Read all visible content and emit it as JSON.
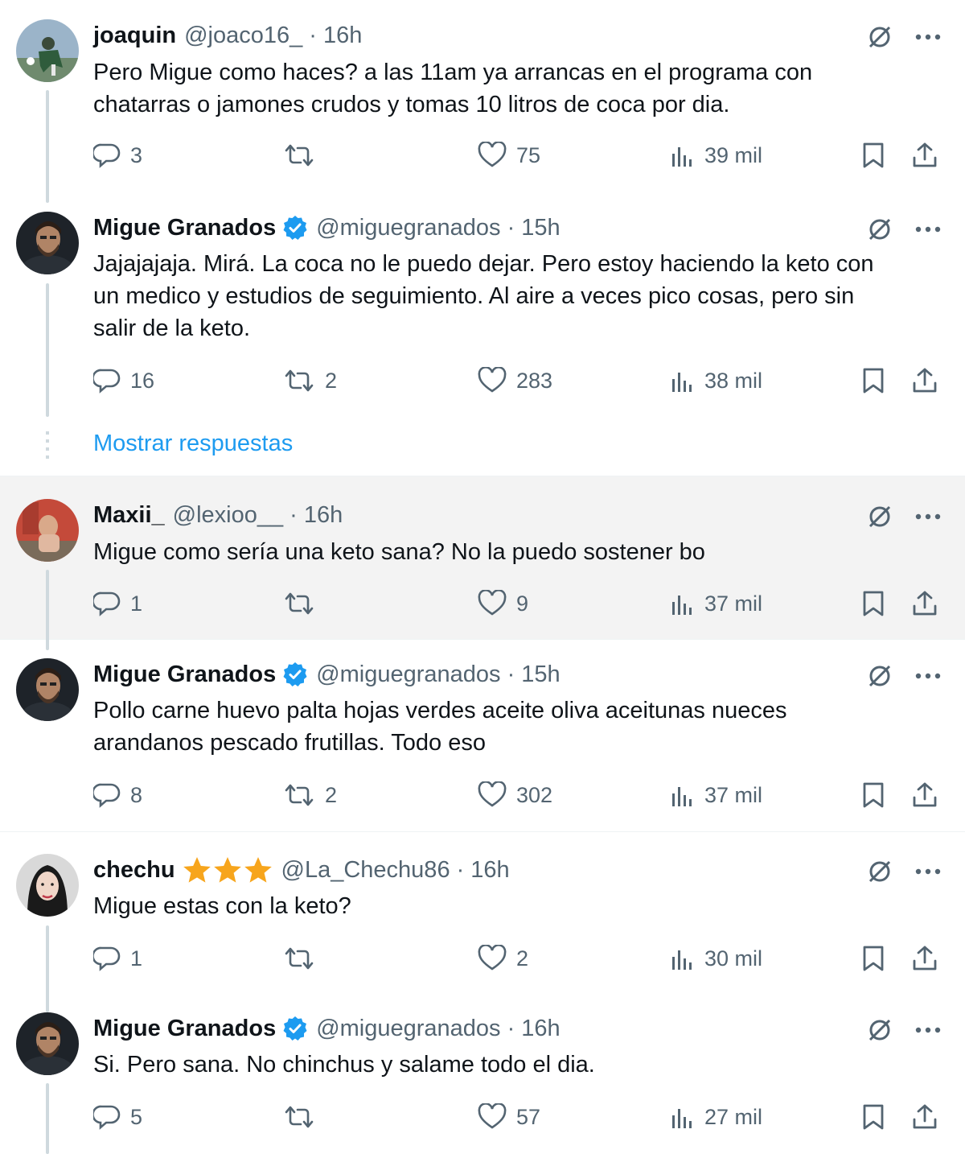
{
  "colors": {
    "link": "#1d9bf0",
    "verified": "#1d9bf0",
    "star": "#f7a51c",
    "muted": "#536471",
    "hover_bg": "#f3f3f3"
  },
  "tweets": [
    {
      "name": "joaquin",
      "handle": "@joaco16_",
      "time": "16h",
      "verified": false,
      "stars": 0,
      "text": "Pero Migue como haces? a las 11am ya arrancas en el programa con\nchatarras o jamones crudos y tomas 10 litros de coca por dia.",
      "replies": "3",
      "retweets": "",
      "likes": "75",
      "views": "39 mil"
    },
    {
      "name": "Migue Granados",
      "handle": "@miguegranados",
      "time": "15h",
      "verified": true,
      "stars": 0,
      "text": "Jajajajaja. Mirá. La coca no le puedo dejar. Pero estoy haciendo la keto con\nun medico y estudios de seguimiento. Al aire a veces pico cosas, pero sin\nsalir de la keto.",
      "replies": "16",
      "retweets": "2",
      "likes": "283",
      "views": "38 mil"
    },
    {
      "name": "Maxii_",
      "handle": "@lexioo__",
      "time": "16h",
      "verified": false,
      "stars": 0,
      "text": "Migue como sería una keto sana? No la puedo sostener bo",
      "replies": "1",
      "retweets": "",
      "likes": "9",
      "views": "37 mil"
    },
    {
      "name": "Migue Granados",
      "handle": "@miguegranados",
      "time": "15h",
      "verified": true,
      "stars": 0,
      "text": "Pollo carne huevo palta hojas verdes aceite oliva aceitunas nueces\narandanos pescado frutillas. Todo eso",
      "replies": "8",
      "retweets": "2",
      "likes": "302",
      "views": "37 mil"
    },
    {
      "name": "chechu",
      "handle": "@La_Chechu86",
      "time": "16h",
      "verified": false,
      "stars": 3,
      "text": "Migue estas con la keto?",
      "replies": "1",
      "retweets": "",
      "likes": "2",
      "views": "30 mil"
    },
    {
      "name": "Migue Granados",
      "handle": "@miguegranados",
      "time": "16h",
      "verified": true,
      "stars": 0,
      "text": "Si. Pero sana. No chinchus y salame todo el dia.",
      "replies": "5",
      "retweets": "",
      "likes": "57",
      "views": "27 mil"
    }
  ],
  "show_replies_label": "Mostrar respuestas",
  "separator_dot": "·"
}
